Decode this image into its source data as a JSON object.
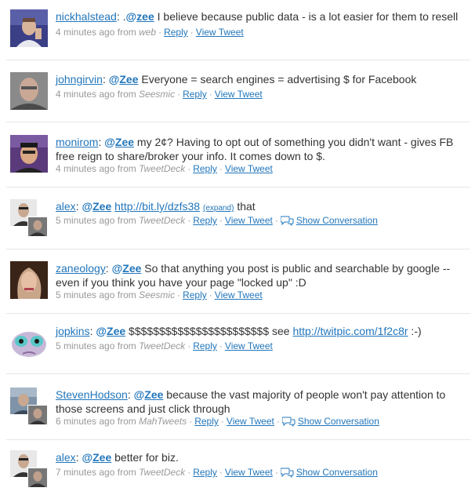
{
  "tweets": [
    {
      "user": "nickhalstead",
      "prefix": ".",
      "mention": "zee",
      "text": " I believe because public data - is a lot easier for them to resell",
      "time": "4 minutes ago",
      "from": "from",
      "source": "web",
      "reply": "Reply",
      "view": "View Tweet"
    },
    {
      "user": "johngirvin",
      "mention": "Zee",
      "text": " Everyone = search engines = advertising $ for Facebook",
      "time": "4 minutes ago",
      "from": "from",
      "source": "Seesmic",
      "reply": "Reply",
      "view": "View Tweet"
    },
    {
      "user": "monirom",
      "mention": "Zee",
      "text": " my 2¢? Having to opt out of something you didn't want - gives FB free reign to share/broker your info. It comes down to $.",
      "time": "4 minutes ago",
      "from": "from",
      "source": "TweetDeck",
      "reply": "Reply",
      "view": "View Tweet"
    },
    {
      "user": "alex",
      "mention": "Zee",
      "pre_link_text": " ",
      "link": "http://bit.ly/dzfs38",
      "expand": "(expand)",
      "text": " that",
      "time": "5 minutes ago",
      "from": "from",
      "source": "TweetDeck",
      "reply": "Reply",
      "view": "View Tweet",
      "convo": "Show Conversation"
    },
    {
      "user": "zaneology",
      "mention": "Zee",
      "text": " So that anything you post is public and searchable by google -- even if you think you have your page \"locked up\" :D",
      "time": "5 minutes ago",
      "from": "from",
      "source": "Seesmic",
      "reply": "Reply",
      "view": "View Tweet"
    },
    {
      "user": "jopkins",
      "mention": "Zee",
      "pre_link_text": " $$$$$$$$$$$$$$$$$$$$$$$ see ",
      "link": "http://twitpic.com/1f2c8r",
      "text": " :-)",
      "time": "5 minutes ago",
      "from": "from",
      "source": "TweetDeck",
      "reply": "Reply",
      "view": "View Tweet"
    },
    {
      "user": "StevenHodson",
      "mention": "Zee",
      "text": " because the vast majority of people won't pay attention to those screens and just click through",
      "time": "6 minutes ago",
      "from": "from",
      "source": "MahTweets",
      "reply": "Reply",
      "view": "View Tweet",
      "convo": "Show Conversation"
    },
    {
      "user": "alex",
      "mention": "Zee",
      "text": " better for biz.",
      "time": "7 minutes ago",
      "from": "from",
      "source": "TweetDeck",
      "reply": "Reply",
      "view": "View Tweet",
      "convo": "Show Conversation"
    }
  ],
  "separators": {
    "colon": ":",
    "at": "@",
    "dot": "·"
  },
  "icons": {
    "conversation": "speech-bubbles-icon"
  },
  "colors": {
    "link": "#2276bb",
    "meta": "#999999",
    "text": "#333333",
    "divider": "#e6e6e6"
  }
}
